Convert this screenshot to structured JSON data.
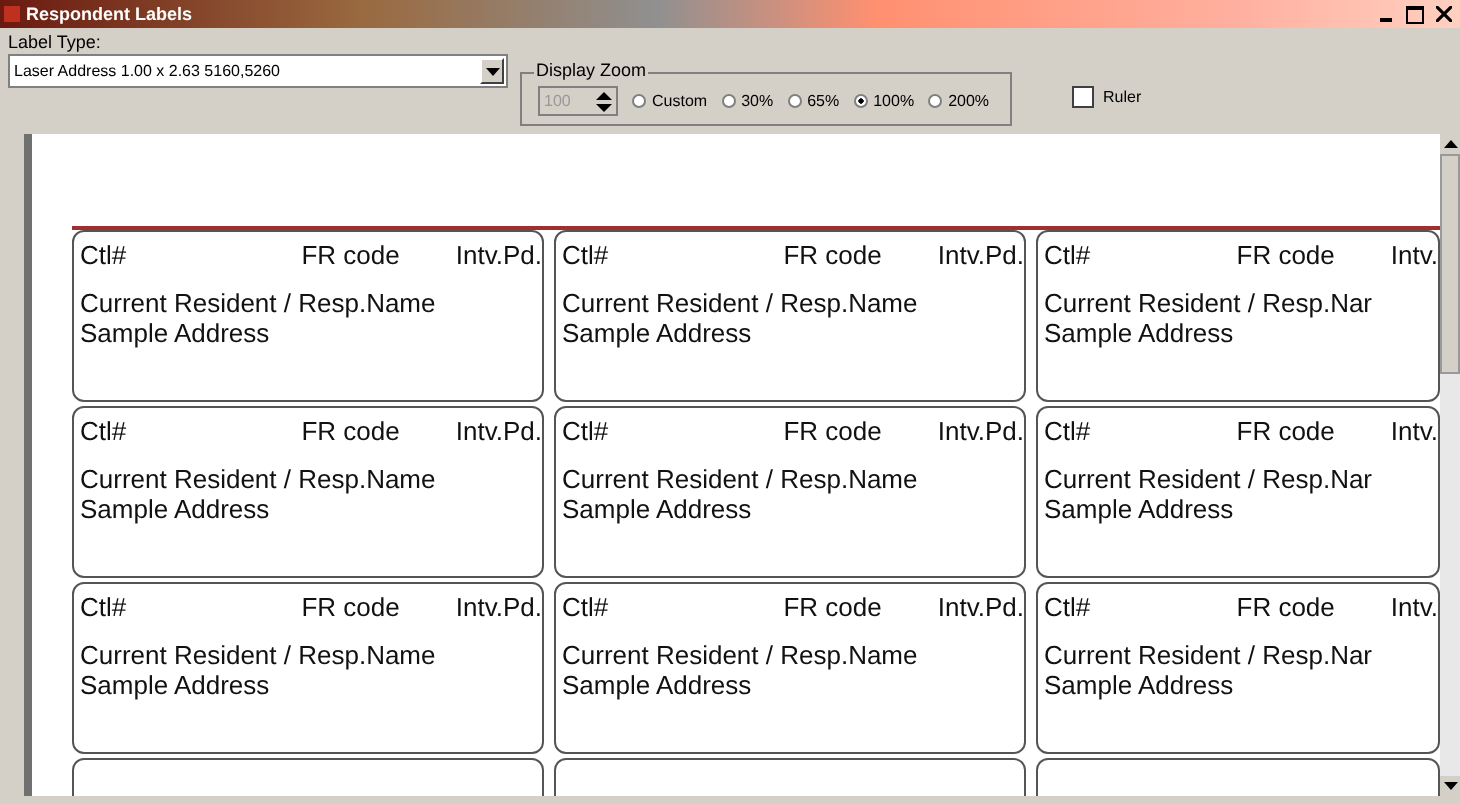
{
  "window": {
    "title": "Respondent Labels"
  },
  "label_type": {
    "label": "Label Type:",
    "value": "Laser Address 1.00 x 2.63 5160,5260"
  },
  "display_zoom": {
    "title": "Display Zoom",
    "spinner": {
      "value": "100",
      "disabled": true
    },
    "options": [
      {
        "label": "Custom",
        "selected": false
      },
      {
        "label": "30%",
        "selected": false
      },
      {
        "label": "65%",
        "selected": false
      },
      {
        "label": "100%",
        "selected": true
      },
      {
        "label": "200%",
        "selected": false
      }
    ]
  },
  "ruler": {
    "label": "Ruler",
    "checked": false
  },
  "labels": [
    {
      "kind": "filled",
      "ctl": "Ctl#",
      "fr_code": "FR code",
      "intv": "Intv.Pd.",
      "name": "Current Resident / Resp.Name",
      "address": "Sample Address"
    },
    {
      "kind": "filled",
      "ctl": "Ctl#",
      "fr_code": "FR code",
      "intv": "Intv.Pd.",
      "name": "Current Resident / Resp.Name",
      "address": "Sample Address"
    },
    {
      "kind": "filled",
      "ctl": "Ctl#",
      "fr_code": "FR code",
      "intv": "Intv.",
      "name": "Current Resident / Resp.Nar",
      "address": "Sample Address"
    },
    {
      "kind": "filled",
      "ctl": "Ctl#",
      "fr_code": "FR code",
      "intv": "Intv.Pd.",
      "name": "Current Resident / Resp.Name",
      "address": "Sample Address"
    },
    {
      "kind": "filled",
      "ctl": "Ctl#",
      "fr_code": "FR code",
      "intv": "Intv.Pd.",
      "name": "Current Resident / Resp.Name",
      "address": "Sample Address"
    },
    {
      "kind": "filled",
      "ctl": "Ctl#",
      "fr_code": "FR code",
      "intv": "Intv.",
      "name": "Current Resident / Resp.Nar",
      "address": "Sample Address"
    },
    {
      "kind": "filled",
      "ctl": "Ctl#",
      "fr_code": "FR code",
      "intv": "Intv.Pd.",
      "name": "Current Resident / Resp.Name",
      "address": "Sample Address"
    },
    {
      "kind": "filled",
      "ctl": "Ctl#",
      "fr_code": "FR code",
      "intv": "Intv.Pd.",
      "name": "Current Resident / Resp.Name",
      "address": "Sample Address"
    },
    {
      "kind": "filled",
      "ctl": "Ctl#",
      "fr_code": "FR code",
      "intv": "Intv.",
      "name": "Current Resident / Resp.Nar",
      "address": "Sample Address"
    },
    {
      "kind": "empty"
    },
    {
      "kind": "empty"
    },
    {
      "kind": "empty"
    }
  ]
}
